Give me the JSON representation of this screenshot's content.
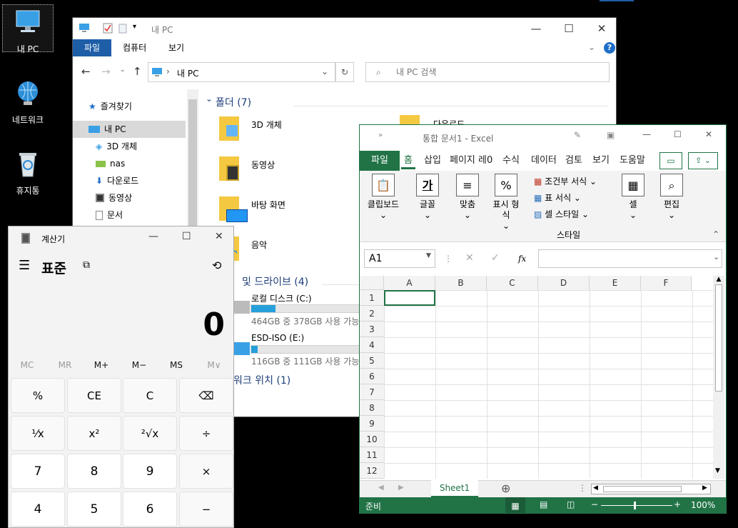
{
  "desktop": {
    "icons": [
      {
        "label": "내 PC",
        "icon": "computer-icon"
      },
      {
        "label": "네트워크",
        "icon": "network-globe-icon"
      },
      {
        "label": "휴지통",
        "icon": "recycle-bin-icon"
      }
    ]
  },
  "explorer": {
    "title": "내 PC",
    "tabs": [
      "파일",
      "컴퓨터",
      "보기"
    ],
    "address": "내 PC",
    "search_placeholder": "내 PC 검색",
    "nav": [
      "즐겨찾기",
      "내 PC",
      "3D 개체",
      "nas",
      "다운로드",
      "동영상",
      "문서"
    ],
    "folders_header": "폴더 (7)",
    "folders": [
      "3D 개체",
      "다운로드",
      "동영상",
      "바탕 화면",
      "음악"
    ],
    "drives_header": "및 드라이브 (4)",
    "drives": [
      {
        "name": "로컬 디스크 (C:)",
        "info": "464GB 중 378GB 사용 가능",
        "used_fraction": 0.19
      },
      {
        "name": "ESD-ISO (E:)",
        "info": "116GB 중 111GB 사용 가능",
        "used_fraction": 0.04
      }
    ],
    "network_header": "워크 위치 (1)"
  },
  "calculator": {
    "title": "계산기",
    "mode": "표준",
    "display": "0",
    "memory": [
      "MC",
      "MR",
      "M+",
      "M−",
      "MS",
      "M∨"
    ],
    "keys": [
      [
        "%",
        "CE",
        "C",
        "⌫"
      ],
      [
        "¹⁄x",
        "x²",
        "²√x",
        "÷"
      ],
      [
        "7",
        "8",
        "9",
        "×"
      ],
      [
        "4",
        "5",
        "6",
        "−"
      ]
    ]
  },
  "excel": {
    "title": "통합 문서1  -  Excel",
    "tabs": [
      "파일",
      "홈",
      "삽입",
      "페이지 레0",
      "수식",
      "데이터",
      "검토",
      "보기",
      "도움말"
    ],
    "groups": {
      "clipboard": "클립보드",
      "font": "글꼴",
      "align": "맞춤",
      "number": "표시 형식",
      "cond": "조건부 서식",
      "table": "표 서식",
      "cellstyle": "셀 스타일",
      "style": "스타일",
      "cells": "셀",
      "edit": "편집"
    },
    "namebox": "A1",
    "fx": "fx",
    "columns": [
      "A",
      "B",
      "C",
      "D",
      "E",
      "F"
    ],
    "rows": [
      "1",
      "2",
      "3",
      "4",
      "5",
      "6",
      "7",
      "8",
      "9",
      "10",
      "11",
      "12"
    ],
    "sheet": "Sheet1",
    "status": "준비",
    "zoom": "100%",
    "accent": "#217346"
  }
}
